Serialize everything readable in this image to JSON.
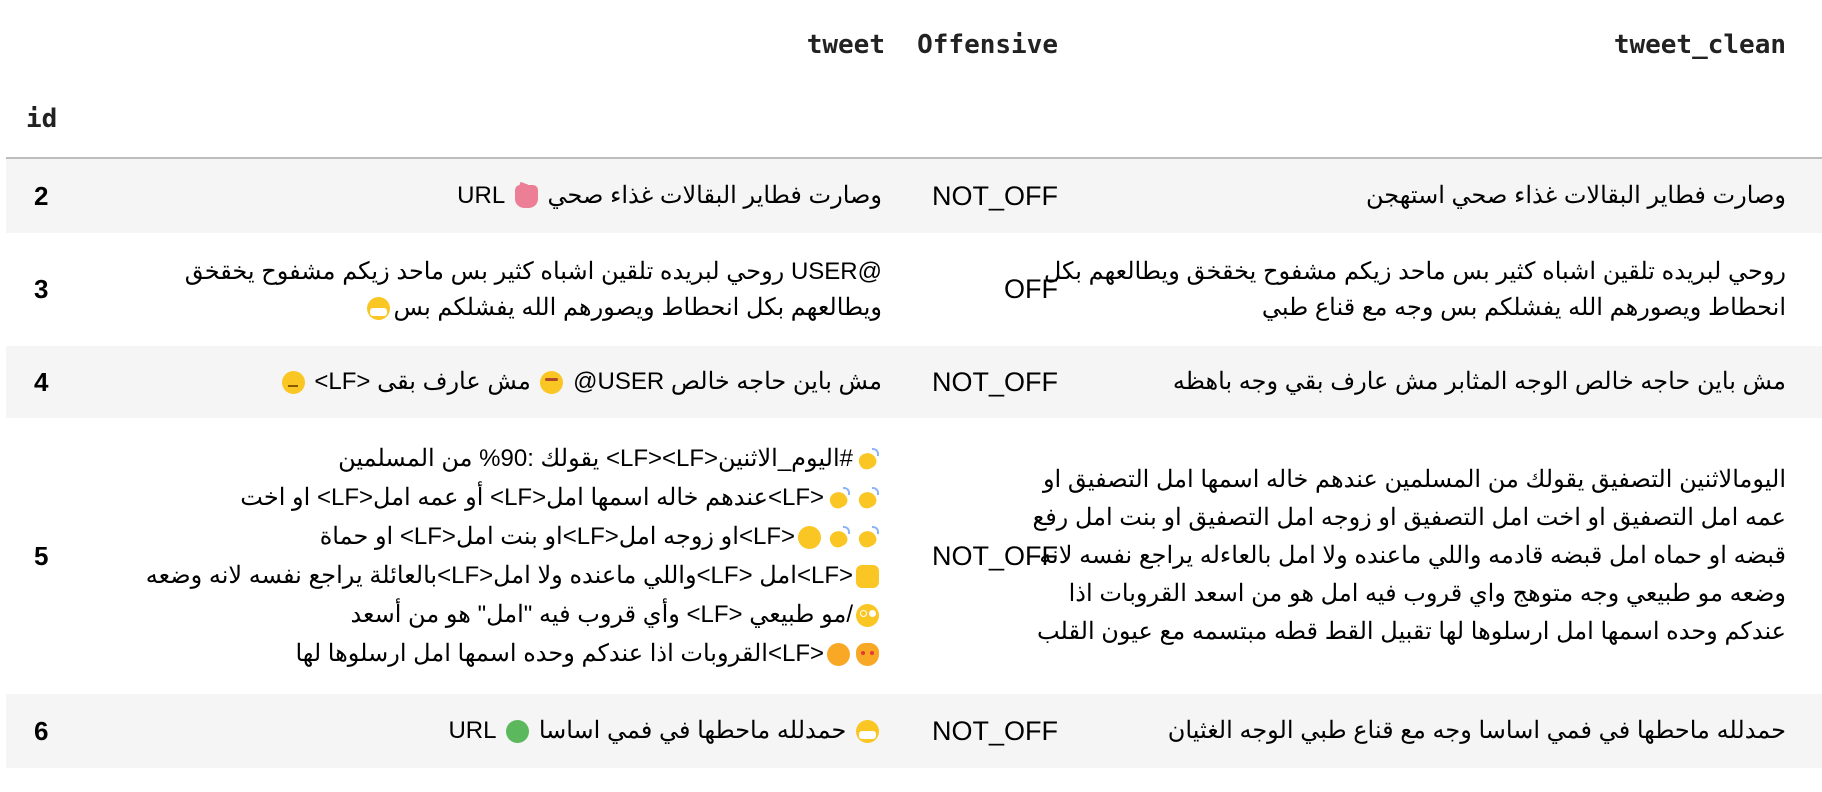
{
  "table": {
    "columns": {
      "tweet": "tweet",
      "offensive": "Offensive",
      "tweet_clean": "tweet_clean",
      "index_name": "id"
    },
    "rows": [
      {
        "id": "2",
        "tweet_a": "وصارت فطاير البقالات غذاء صحي",
        "tweet_b": "URL",
        "offensive": "NOT_OFF",
        "tweet_clean": "وصارت فطاير البقالات غذاء صحي استهجن"
      },
      {
        "id": "3",
        "tweet_line1": "@USER روحي لبريده تلقين اشباه كثير بس ماحد زيكم مشفوح يخقخق",
        "tweet_line2": "ويطالعهم بكل انحطاط ويصورهم الله يفشلكم بس",
        "offensive": "OFF",
        "tweet_clean": "روحي لبريده تلقين اشباه كثير بس ماحد زيكم مشفوح يخقخق ويطالعهم بكل انحطاط ويصورهم الله يفشلكم بس وجه مع قناع طبي"
      },
      {
        "id": "4",
        "tweet_a": "@USER مش باين حاجه خالص",
        "tweet_b": "<LF> مش عارف بقى",
        "offensive": "NOT_OFF",
        "tweet_clean": "مش باين حاجه خالص الوجه المثابر مش عارف بقي وجه باهظه"
      },
      {
        "id": "5",
        "tweet_lines": [
          "#اليوم_الاثنين<LF><LF> يقولك :90% من المسلمين",
          "<LF>عندهم خاله اسمها امل<LF> أو عمه امل<LF> او اخت",
          "<LF>او زوجه امل<LF>او بنت امل<LF> او حماة",
          "<LF>امل <LF>واللي ماعنده ولا امل<LF>بالعائلة يراجع نفسه لانه وضعه",
          "/مو طبيعي <LF> وأي قروب فيه \"امل\" هو من أسعد",
          "<LF>القروبات اذا عندكم وحده اسمها امل ارسلوها لها"
        ],
        "offensive": "NOT_OFF",
        "tweet_clean": "اليومالاثنين التصفيق يقولك من المسلمين عندهم خاله اسمها امل التصفيق او عمه امل التصفيق او اخت امل التصفيق او زوجه امل التصفيق او بنت امل رفع قبضه او حماه امل قبضه قادمه واللي ماعنده ولا امل بالعاءله يراجع نفسه لانه وضعه مو طبيعي وجه متوهج واي قروب فيه امل هو من اسعد القروبات اذا عندكم وحده اسمها امل ارسلوها لها تقبيل القط قطه مبتسمه مع عيون القلب"
      },
      {
        "id": "6",
        "tweet_a": "حمدلله ماحطها في فمي اساسا",
        "tweet_b": "URL",
        "offensive": "NOT_OFF",
        "tweet_clean": "حمدلله ماحطها في فمي اساسا وجه مع قناع طبي الوجه الغثيان"
      }
    ]
  },
  "icons": {
    "thumbs_down": "thumbs-down-icon",
    "face_mask": "face-with-mask-icon",
    "pensive": "pensive-face-icon",
    "angry": "angry-face-icon",
    "clap": "clapping-hands-icon",
    "raised_fist": "raised-fist-icon",
    "oncoming_fist": "oncoming-fist-icon",
    "flushed": "flushed-face-icon",
    "kissing_cat": "kissing-cat-icon",
    "heart_eyes_cat": "heart-eyes-cat-icon",
    "nauseated": "nauseated-face-icon"
  },
  "colors": {
    "alt_row": "#f5f5f5",
    "header_rule": "#bdbdbd"
  }
}
